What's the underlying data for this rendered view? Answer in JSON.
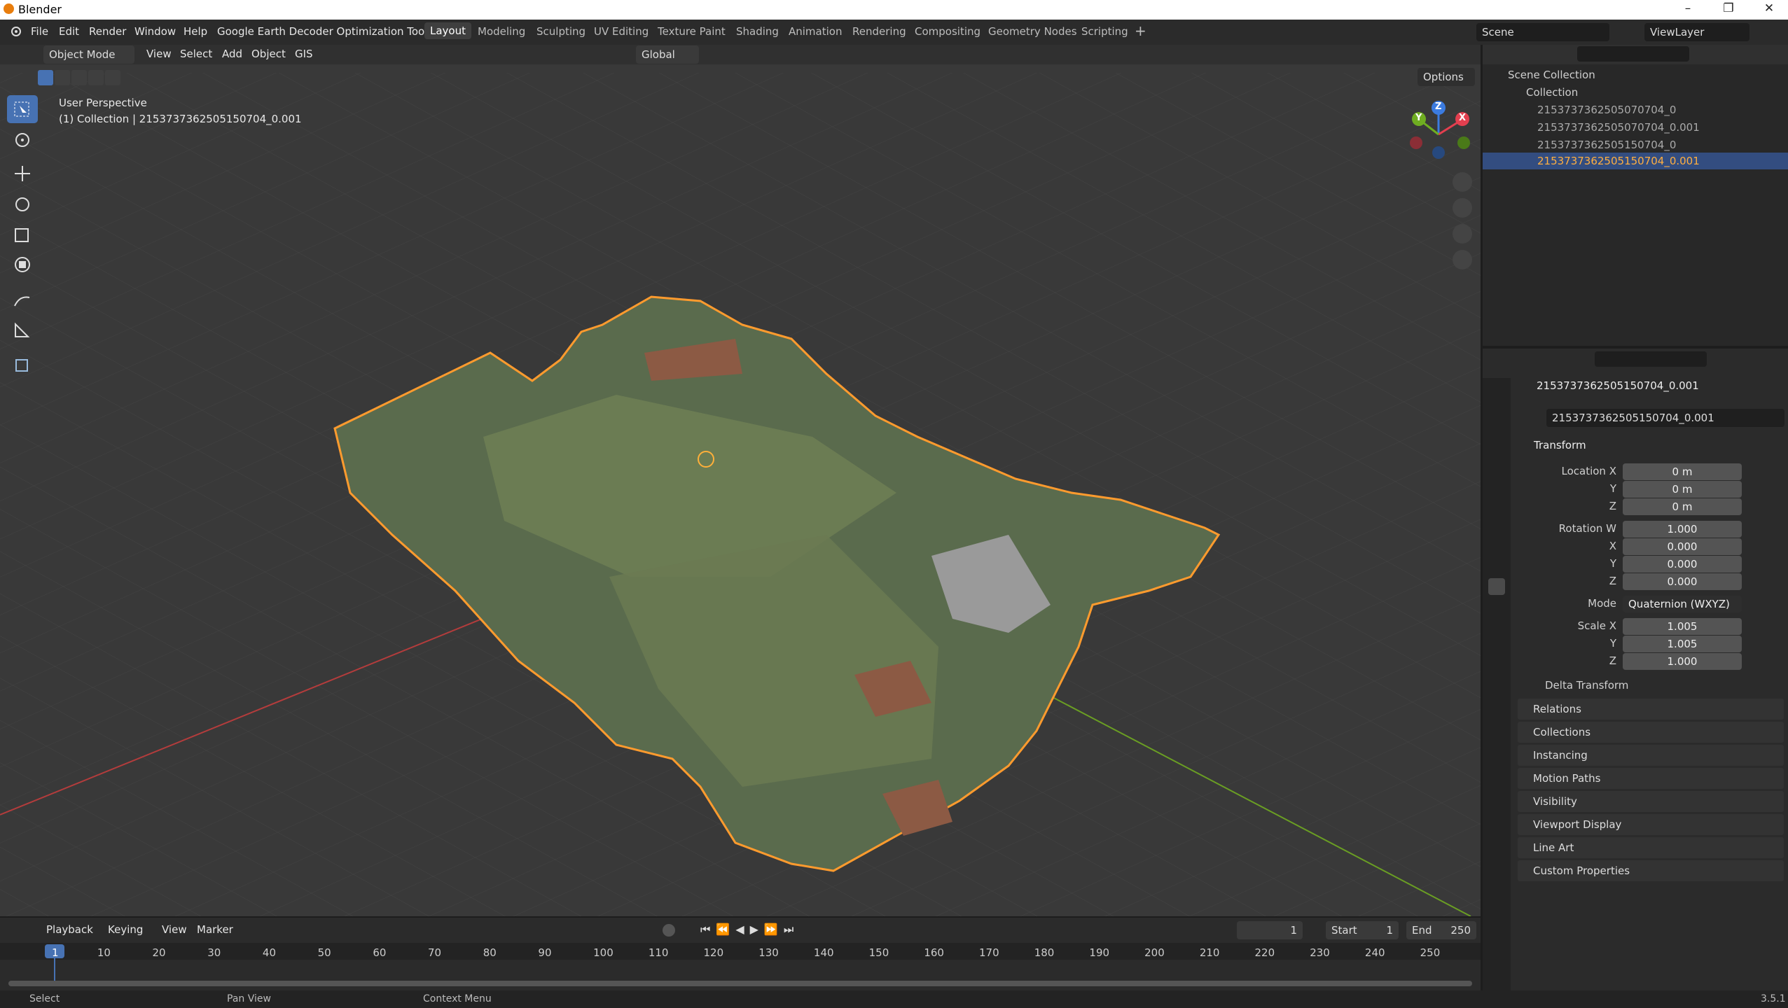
{
  "window": {
    "title": "Blender",
    "version": "3.5.1"
  },
  "menus": [
    "File",
    "Edit",
    "Render",
    "Window",
    "Help",
    "Google Earth Decoder Optimization Tools"
  ],
  "workspaces": [
    "Layout",
    "Modeling",
    "Sculpting",
    "UV Editing",
    "Texture Paint",
    "Shading",
    "Animation",
    "Rendering",
    "Compositing",
    "Geometry Nodes",
    "Scripting"
  ],
  "active_workspace": "Layout",
  "scene": {
    "name": "Scene",
    "view_layer": "ViewLayer"
  },
  "viewport_header": {
    "mode": "Object Mode",
    "menus": [
      "View",
      "Select",
      "Add",
      "Object",
      "GIS"
    ],
    "orientation": "Global",
    "options_label": "Options"
  },
  "viewport_overlay": {
    "perspective": "User Perspective",
    "collection_line": "(1) Collection | 2153737362505150704_0.001"
  },
  "gizmo": {
    "x": "X",
    "y": "Y",
    "z": "Z"
  },
  "outliner": {
    "root": "Scene Collection",
    "collection": "Collection",
    "items": [
      {
        "name": "2153737362505070704_0",
        "selected": false
      },
      {
        "name": "2153737362505070704_0.001",
        "selected": false
      },
      {
        "name": "2153737362505150704_0",
        "selected": false
      },
      {
        "name": "2153737362505150704_0.001",
        "selected": true
      }
    ]
  },
  "properties": {
    "object_name": "2153737362505150704_0.001",
    "object_field": "2153737362505150704_0.001",
    "transform_label": "Transform",
    "location": {
      "label": "Location X",
      "x": "0 m",
      "y": "0 m",
      "z": "0 m"
    },
    "rotation": {
      "label": "Rotation W",
      "w": "1.000",
      "x": "0.000",
      "y": "0.000",
      "z": "0.000"
    },
    "mode_label": "Mode",
    "mode_value": "Quaternion (WXYZ)",
    "scale": {
      "label": "Scale X",
      "x": "1.005",
      "y": "1.005",
      "z": "1.000"
    },
    "axis_y": "Y",
    "axis_z": "Z",
    "axis_x": "X",
    "delta_transform": "Delta Transform",
    "panels": [
      "Relations",
      "Collections",
      "Instancing",
      "Motion Paths",
      "Visibility",
      "Viewport Display",
      "Line Art",
      "Custom Properties"
    ]
  },
  "timeline": {
    "menus": [
      "Playback",
      "Keying",
      "View",
      "Marker"
    ],
    "current_frame": "1",
    "start_label": "Start",
    "start": "1",
    "end_label": "End",
    "end": "250",
    "ticks": [
      "1",
      "10",
      "20",
      "30",
      "40",
      "50",
      "60",
      "70",
      "80",
      "90",
      "100",
      "110",
      "120",
      "130",
      "140",
      "150",
      "160",
      "170",
      "180",
      "190",
      "200",
      "210",
      "220",
      "230",
      "240",
      "250"
    ]
  },
  "status": {
    "select": "Select",
    "pan": "Pan View",
    "context": "Context Menu"
  },
  "colors": {
    "accent": "#4772b3",
    "selection": "#ff9b2e",
    "axis_x": "#c0403f",
    "axis_y": "#6a9e23"
  }
}
